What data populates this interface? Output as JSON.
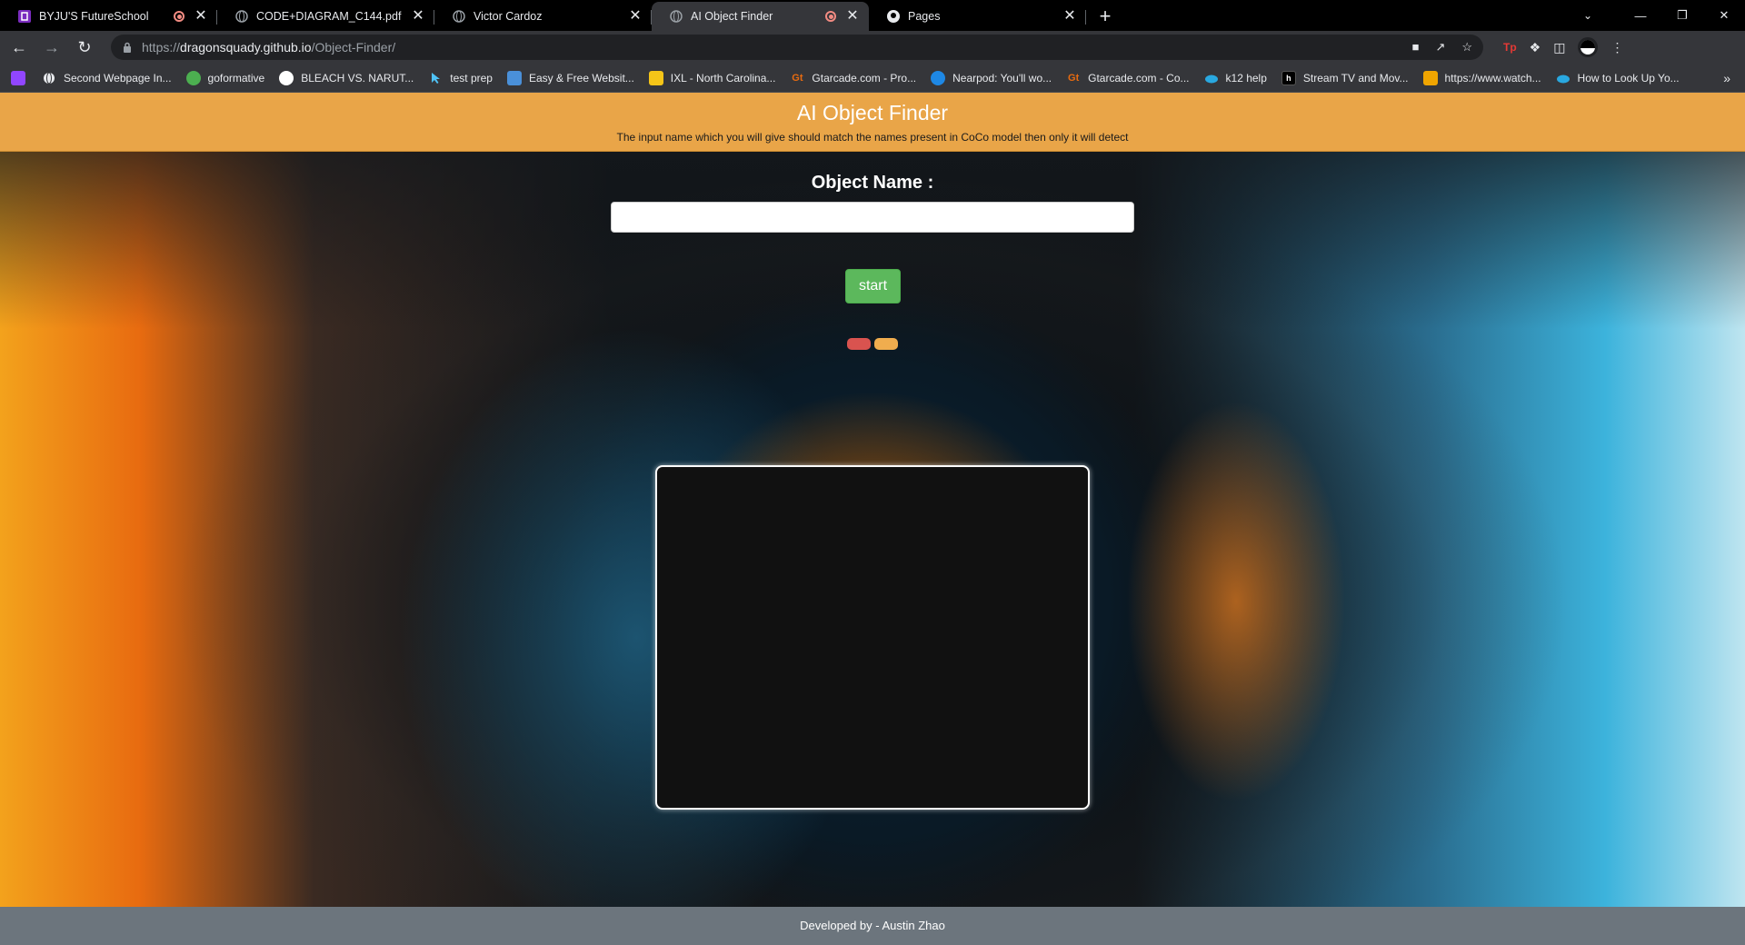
{
  "browser": {
    "tabs": [
      {
        "title": "BYJU'S FutureSchool",
        "icon": "byjus-icon",
        "recording": true,
        "active": false
      },
      {
        "title": "CODE+DIAGRAM_C144.pdf",
        "icon": "globe-icon",
        "recording": false,
        "active": false
      },
      {
        "title": "Victor Cardoz",
        "icon": "globe-icon",
        "recording": false,
        "active": false
      },
      {
        "title": "AI Object Finder",
        "icon": "globe-icon",
        "recording": true,
        "active": true
      },
      {
        "title": "Pages",
        "icon": "github-icon",
        "recording": false,
        "active": false
      }
    ],
    "new_tab": "+",
    "url_scheme": "https://",
    "url_host": "dragonsquady.github.io",
    "url_path": "/Object-Finder/",
    "bookmarks": [
      {
        "label": "Second Webpage In...",
        "icon": "globe-icon",
        "color": "#5f6368"
      },
      {
        "label": "goformative",
        "icon": "goformative-icon",
        "color": "#4caf50"
      },
      {
        "label": "BLEACH VS. NARUT...",
        "icon": "bleach-icon",
        "color": "#ffffff"
      },
      {
        "label": "test prep",
        "icon": "cursor-icon",
        "color": "#4fc3f7"
      },
      {
        "label": "Easy & Free Websit...",
        "icon": "weebly-icon",
        "color": "#4a90d9"
      },
      {
        "label": "IXL - North Carolina...",
        "icon": "ixl-icon",
        "color": "#f5c518"
      },
      {
        "label": "Gtarcade.com - Pro...",
        "icon": "gtarcade-icon",
        "color": "#e86b10"
      },
      {
        "label": "Nearpod: You'll wo...",
        "icon": "nearpod-icon",
        "color": "#1e88e5"
      },
      {
        "label": "Gtarcade.com - Co...",
        "icon": "gtarcade-icon",
        "color": "#e86b10"
      },
      {
        "label": "k12 help",
        "icon": "cloud-icon",
        "color": "#29a8e0"
      },
      {
        "label": "Stream TV and Mov...",
        "icon": "hulu-icon",
        "color": "#000000"
      },
      {
        "label": "https://www.watch...",
        "icon": "watch-icon",
        "color": "#f0a500"
      },
      {
        "label": "How to Look Up Yo...",
        "icon": "cloud-icon",
        "color": "#29a8e0"
      }
    ]
  },
  "page": {
    "title": "AI Object Finder",
    "subtitle": "The input name which you will give should match the names present in CoCo model then only it will detect",
    "object_label": "Object Name :",
    "object_input_value": "",
    "start_button": "start",
    "footer": "Developed by - Austin Zhao"
  }
}
